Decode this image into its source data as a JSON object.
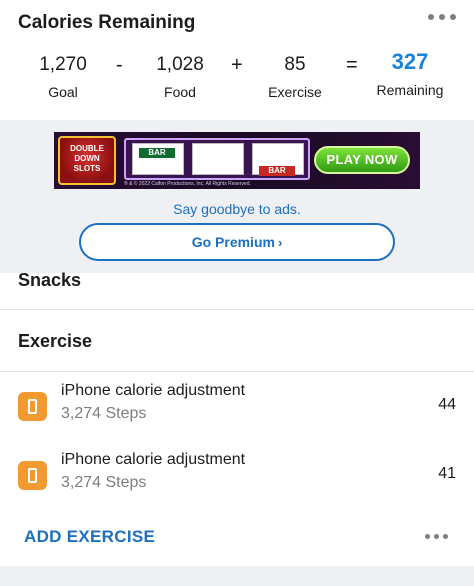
{
  "summary": {
    "title": "Calories Remaining",
    "goal": {
      "value": "1,270",
      "label": "Goal"
    },
    "op1": "-",
    "food": {
      "value": "1,028",
      "label": "Food"
    },
    "op2": "+",
    "exercise": {
      "value": "85",
      "label": "Exercise"
    },
    "op3": "=",
    "remaining": {
      "value": "327",
      "label": "Remaining"
    },
    "accent_color": "#1d82d7"
  },
  "ad": {
    "logo_text": "DOUBLE DOWN SLOTS",
    "reel_tag": "BAR",
    "play_label": "PLAY NOW",
    "copyright": "® & © 2022 Calfon Productions, Inc. All Rights Reserved.",
    "goodbye_text": "Say goodbye to ads.",
    "premium_label": "Go Premium",
    "premium_chevron": "›"
  },
  "snacks": {
    "title": "Snacks"
  },
  "exercise": {
    "title": "Exercise",
    "items": [
      {
        "name": "iPhone calorie adjustment",
        "detail": "3,274 Steps",
        "value": "44",
        "icon": "phone-icon"
      },
      {
        "name": "iPhone calorie adjustment",
        "detail": "3,274 Steps",
        "value": "41",
        "icon": "phone-icon"
      }
    ],
    "add_label": "ADD EXERCISE"
  },
  "colors": {
    "link": "#1d6fbf",
    "exercise_icon_bg": "#f19a32",
    "ad_area_bg": "#eff0f4"
  }
}
